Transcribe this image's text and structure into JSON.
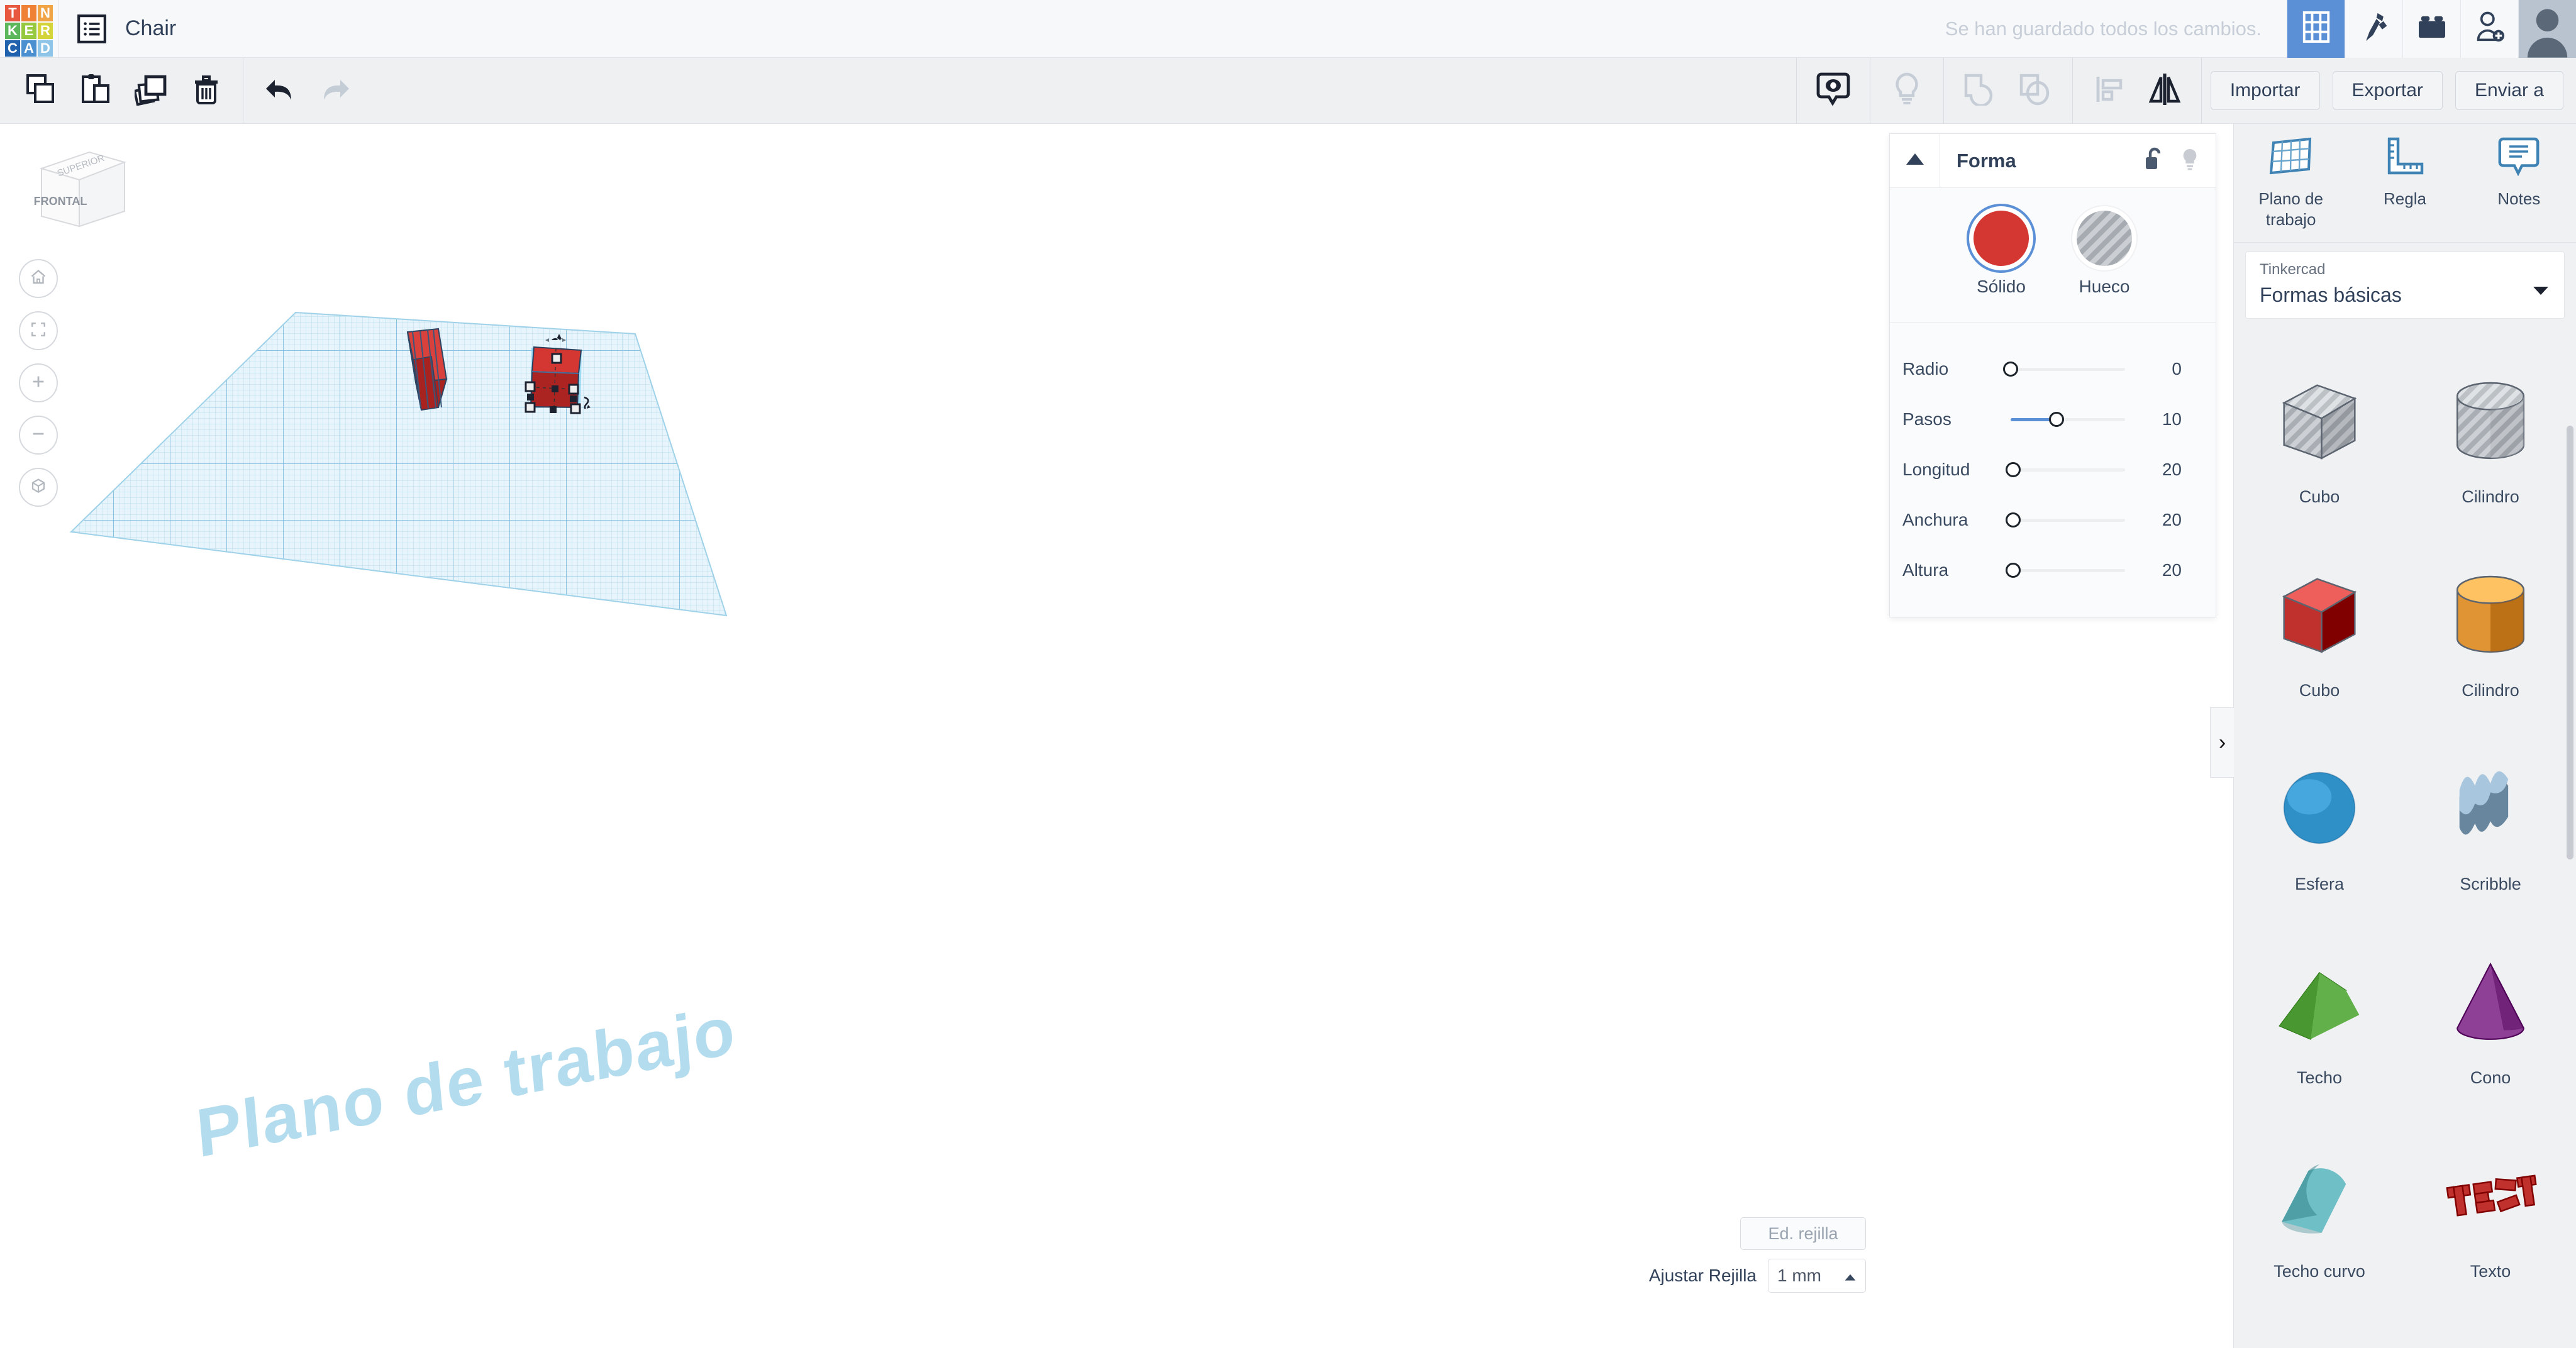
{
  "header": {
    "logo_letters": [
      {
        "ch": "T",
        "color": "#e8573f"
      },
      {
        "ch": "I",
        "color": "#ef8136"
      },
      {
        "ch": "N",
        "color": "#f0a446"
      },
      {
        "ch": "K",
        "color": "#5cb75c"
      },
      {
        "ch": "E",
        "color": "#96c93d"
      },
      {
        "ch": "R",
        "color": "#d4d339"
      },
      {
        "ch": "C",
        "color": "#2062ad"
      },
      {
        "ch": "A",
        "color": "#4a8fd0"
      },
      {
        "ch": "D",
        "color": "#8ec4e8"
      }
    ],
    "document_icon": "list-document-icon",
    "title": "Chair",
    "save_status": "Se han guardado todos los cambios.",
    "buttons": [
      {
        "name": "grid-apps-button",
        "icon": "grid-icon",
        "active": true
      },
      {
        "name": "codeblocks-button",
        "icon": "pickaxe-icon",
        "active": false
      },
      {
        "name": "blocks-button",
        "icon": "brick-icon",
        "active": false
      },
      {
        "name": "invite-button",
        "icon": "add-person-icon",
        "active": false
      }
    ],
    "avatar": "user-avatar"
  },
  "toolbar": {
    "left_buttons": [
      {
        "name": "copy-button",
        "icon": "copy-icon",
        "label": "Copiar",
        "enabled": true
      },
      {
        "name": "paste-button",
        "icon": "paste-icon",
        "label": "Pegar",
        "enabled": true
      },
      {
        "name": "duplicate-button",
        "icon": "duplicate-icon",
        "label": "Duplicar",
        "enabled": true
      },
      {
        "name": "delete-button",
        "icon": "trash-icon",
        "label": "Eliminar",
        "enabled": true
      }
    ],
    "history_buttons": [
      {
        "name": "undo-button",
        "icon": "undo-arrow-icon",
        "label": "Deshacer",
        "enabled": true
      },
      {
        "name": "redo-button",
        "icon": "redo-arrow-icon",
        "label": "Rehacer",
        "enabled": false
      }
    ],
    "right_icon_buttons": [
      {
        "name": "view-marker-button",
        "icon": "view-marker-icon",
        "enabled": true
      },
      {
        "name": "light-button",
        "icon": "lightbulb-icon",
        "enabled": false
      },
      {
        "name": "group-button",
        "icon": "group-shapes-icon",
        "enabled": false
      },
      {
        "name": "ungroup-button",
        "icon": "ungroup-shapes-icon",
        "enabled": false
      },
      {
        "name": "align-button",
        "icon": "align-icon",
        "enabled": true
      },
      {
        "name": "mirror-button",
        "icon": "mirror-icon",
        "enabled": true
      }
    ],
    "text_buttons": [
      {
        "name": "import-button",
        "label": "Importar"
      },
      {
        "name": "export-button",
        "label": "Exportar"
      },
      {
        "name": "send-to-button",
        "label": "Enviar a"
      }
    ]
  },
  "canvas": {
    "viewcube": {
      "top_face": "SUPERIOR",
      "front_face": "FRONTAL"
    },
    "nav_buttons": [
      {
        "name": "home-view-button",
        "icon": "home-icon"
      },
      {
        "name": "fit-view-button",
        "icon": "fit-frame-icon"
      },
      {
        "name": "zoom-in-button",
        "icon": "plus-icon"
      },
      {
        "name": "zoom-out-button",
        "icon": "minus-icon"
      },
      {
        "name": "projection-toggle-button",
        "icon": "box-projection-icon"
      }
    ],
    "workplane_label": "Plano de trabajo",
    "grid_edit_button": "Ed. rejilla",
    "snap_label": "Ajustar Rejilla",
    "snap_value": "1 mm",
    "objects": [
      {
        "name": "chair-legs-group",
        "color": "#b02523",
        "selected": false
      },
      {
        "name": "chair-seat-box",
        "color": "#d43632",
        "selected": true
      }
    ]
  },
  "forma_panel": {
    "title": "Forma",
    "collapse_icon": "chevron-up-icon",
    "lock_icon": "unlock-icon",
    "light_icon": "lightbulb-icon",
    "swatches": [
      {
        "name": "solid-swatch",
        "label": "Sólido",
        "color": "#d43632",
        "selected": true
      },
      {
        "name": "hollow-swatch",
        "label": "Hueco",
        "color": "#b9bcc0",
        "selected": false
      }
    ],
    "sliders": [
      {
        "label": "Radio",
        "value": "0",
        "fill_pct": 0,
        "knob_pct": 0
      },
      {
        "label": "Pasos",
        "value": "10",
        "fill_pct": 40,
        "knob_pct": 40
      },
      {
        "label": "Longitud",
        "value": "20",
        "fill_pct": 0,
        "knob_pct": 2
      },
      {
        "label": "Anchura",
        "value": "20",
        "fill_pct": 0,
        "knob_pct": 2
      },
      {
        "label": "Altura",
        "value": "20",
        "fill_pct": 0,
        "knob_pct": 2
      }
    ]
  },
  "right_panel": {
    "tools": [
      {
        "name": "workplane-tool",
        "label": "Plano de trabajo",
        "icon": "workplane-grid-icon"
      },
      {
        "name": "ruler-tool",
        "label": "Regla",
        "icon": "ruler-icon"
      },
      {
        "name": "notes-tool",
        "label": "Notes",
        "icon": "note-bubble-icon"
      }
    ],
    "dropdown": {
      "category": "Tinkercad",
      "value": "Formas básicas",
      "caret": "chevron-down-icon"
    },
    "shapes": [
      {
        "name": "shape-cubo-hollow",
        "label": "Cubo",
        "kind": "cube",
        "color": "#b9bcc0",
        "hollow": true
      },
      {
        "name": "shape-cilindro-hollow",
        "label": "Cilindro",
        "kind": "cylinder",
        "color": "#b9bcc0",
        "hollow": true
      },
      {
        "name": "shape-cubo",
        "label": "Cubo",
        "kind": "cube",
        "color": "#c0302c",
        "hollow": false
      },
      {
        "name": "shape-cilindro",
        "label": "Cilindro",
        "kind": "cylinder",
        "color": "#e09434",
        "hollow": false
      },
      {
        "name": "shape-esfera",
        "label": "Esfera",
        "kind": "sphere",
        "color": "#2f90c8",
        "hollow": false
      },
      {
        "name": "shape-scribble",
        "label": "Scribble",
        "kind": "scribble",
        "color": "#a8c6de",
        "hollow": false
      },
      {
        "name": "shape-techo",
        "label": "Techo",
        "kind": "roof",
        "color": "#62b04a",
        "hollow": false
      },
      {
        "name": "shape-cono",
        "label": "Cono",
        "kind": "cone",
        "color": "#8e3f96",
        "hollow": false
      },
      {
        "name": "shape-techo-curvo",
        "label": "Techo curvo",
        "kind": "curvedroof",
        "color": "#6fbfc6",
        "hollow": false
      },
      {
        "name": "shape-texto",
        "label": "Texto",
        "kind": "text",
        "color": "#c0302c",
        "hollow": false
      }
    ]
  }
}
